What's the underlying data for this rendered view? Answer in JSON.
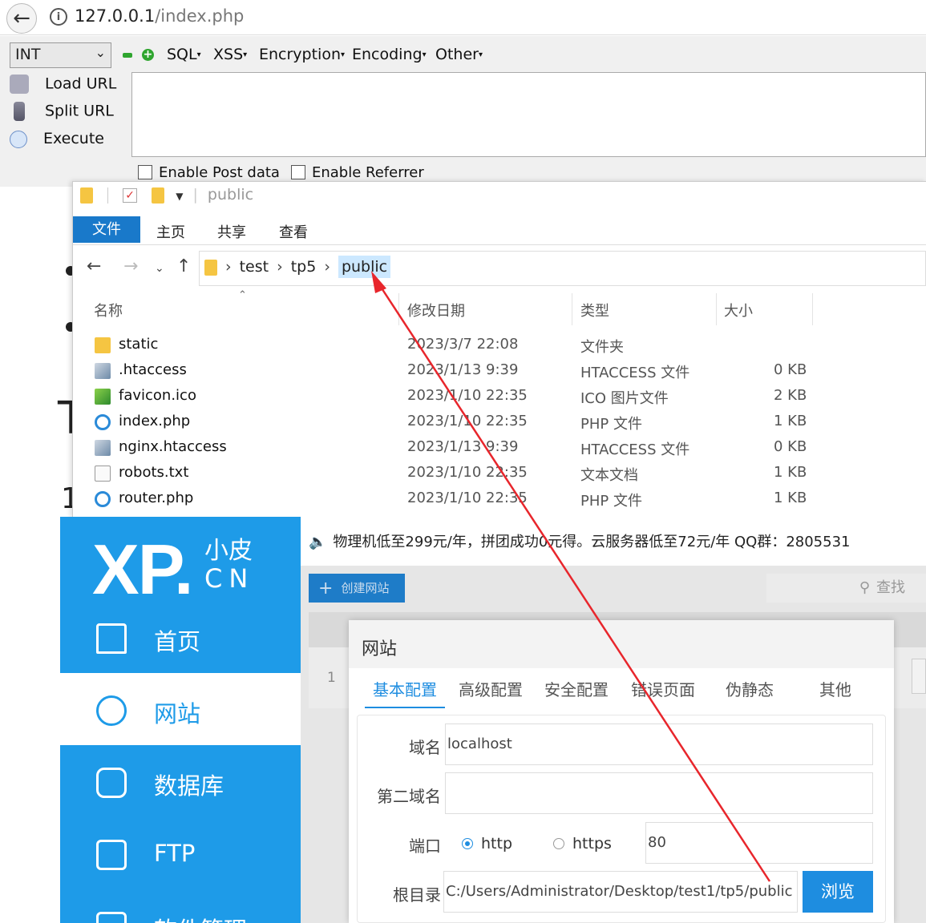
{
  "browser": {
    "url_host": "127.0.0.1",
    "url_path": "/index.php"
  },
  "hackbar": {
    "select_value": "INT",
    "menus": [
      "SQL",
      "XSS",
      "Encryption",
      "Encoding",
      "Other"
    ],
    "load_url": "Load URL",
    "split_url": "Split URL",
    "execute": "Execute",
    "enable_post": "Enable Post data",
    "enable_referrer": "Enable Referrer"
  },
  "background_page": {
    "glyph_t": "T",
    "glyph_1": "1"
  },
  "explorer": {
    "title": "public",
    "ribbon_tabs": [
      "文件",
      "主页",
      "共享",
      "查看"
    ],
    "breadcrumb": [
      "test",
      "tp5",
      "public"
    ],
    "columns": [
      "名称",
      "修改日期",
      "类型",
      "大小"
    ],
    "files": [
      {
        "name": "static",
        "date": "2023/3/7 22:08",
        "type": "文件夹",
        "size": "",
        "icon": "folder-icon"
      },
      {
        "name": ".htaccess",
        "date": "2023/1/13 9:39",
        "type": "HTACCESS 文件",
        "size": "0 KB",
        "icon": "htaccess-file-icon"
      },
      {
        "name": "favicon.ico",
        "date": "2023/1/10 22:35",
        "type": "ICO 图片文件",
        "size": "2 KB",
        "icon": "image-file-icon"
      },
      {
        "name": "index.php",
        "date": "2023/1/10 22:35",
        "type": "PHP 文件",
        "size": "1 KB",
        "icon": "ie-file-icon"
      },
      {
        "name": "nginx.htaccess",
        "date": "2023/1/13 9:39",
        "type": "HTACCESS 文件",
        "size": "0 KB",
        "icon": "htaccess-file-icon"
      },
      {
        "name": "robots.txt",
        "date": "2023/1/10 22:35",
        "type": "文本文档",
        "size": "1 KB",
        "icon": "text-file-icon"
      },
      {
        "name": "router.php",
        "date": "2023/1/10 22:35",
        "type": "PHP 文件",
        "size": "1 KB",
        "icon": "ie-file-icon"
      }
    ]
  },
  "xp": {
    "logo": "XP.",
    "logo_cn_top": "小皮",
    "logo_cn_bottom": "CN",
    "nav": [
      "首页",
      "网站",
      "数据库",
      "FTP",
      "软件管理"
    ],
    "notice": "物理机低至299元/年，拼团成功0元得。云服务器低至72元/年 QQ群：2805531",
    "create_site": "创建网站",
    "search": "查找",
    "row_number": "1",
    "dialog": {
      "title": "网站",
      "tabs": [
        "基本配置",
        "高级配置",
        "安全配置",
        "错误页面",
        "伪静态",
        "其他"
      ],
      "domain_label": "域名",
      "domain_value": "localhost",
      "second_domain_label": "第二域名",
      "second_domain_value": "",
      "port_label": "端口",
      "protocol_http": "http",
      "protocol_https": "https",
      "selected_protocol": "http",
      "port_value": "80",
      "root_label": "根目录",
      "root_value": "C:/Users/Administrator/Desktop/test1/tp5/public",
      "browse": "浏览"
    }
  },
  "colors": {
    "xp_blue": "#1e9be8",
    "explorer_blue": "#1979ca",
    "annotation_red": "#e8262c"
  }
}
